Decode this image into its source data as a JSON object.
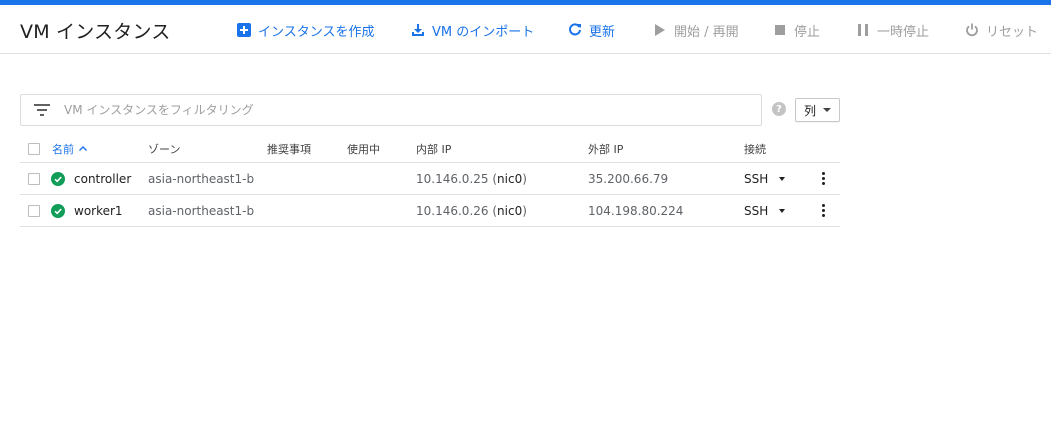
{
  "header": {
    "title": "VM インスタンス"
  },
  "toolbar": {
    "create_label": "インスタンスを作成",
    "import_label": "VM のインポート",
    "refresh_label": "更新",
    "start_label": "開始 / 再開",
    "stop_label": "停止",
    "suspend_label": "一時停止",
    "reset_label": "リセット"
  },
  "filter": {
    "placeholder": "VM インスタンスをフィルタリング",
    "value": ""
  },
  "columns_button": {
    "label": "列"
  },
  "table": {
    "headers": {
      "name": "名前",
      "zone": "ゾーン",
      "recommendation": "推奨事項",
      "in_use_by": "使用中",
      "internal_ip": "内部 IP",
      "external_ip": "外部 IP",
      "connect": "接続"
    },
    "rows": [
      {
        "status": "running",
        "name": "controller",
        "zone": "asia-northeast1-b",
        "recommendation": "",
        "in_use_by": "",
        "internal_ip": "10.146.0.25",
        "internal_nic": "nic0",
        "external_ip": "35.200.66.79",
        "connect": "SSH"
      },
      {
        "status": "running",
        "name": "worker1",
        "zone": "asia-northeast1-b",
        "recommendation": "",
        "in_use_by": "",
        "internal_ip": "10.146.0.26",
        "internal_nic": "nic0",
        "external_ip": "104.198.80.224",
        "connect": "SSH"
      }
    ]
  },
  "colors": {
    "accent": "#1a73e8",
    "disabled": "#9e9e9e",
    "status_ok": "#0f9d58",
    "divider": "#e0e0e0"
  },
  "icons": {
    "create": "add-box-icon",
    "import": "download-icon",
    "refresh": "refresh-icon",
    "start": "play-icon",
    "stop": "stop-icon",
    "suspend": "pause-icon",
    "reset": "power-icon",
    "filter": "filter-list-icon",
    "help": "help-icon",
    "sort": "arrow-up-icon",
    "status": "check-circle-icon",
    "more": "more-vert-icon"
  }
}
